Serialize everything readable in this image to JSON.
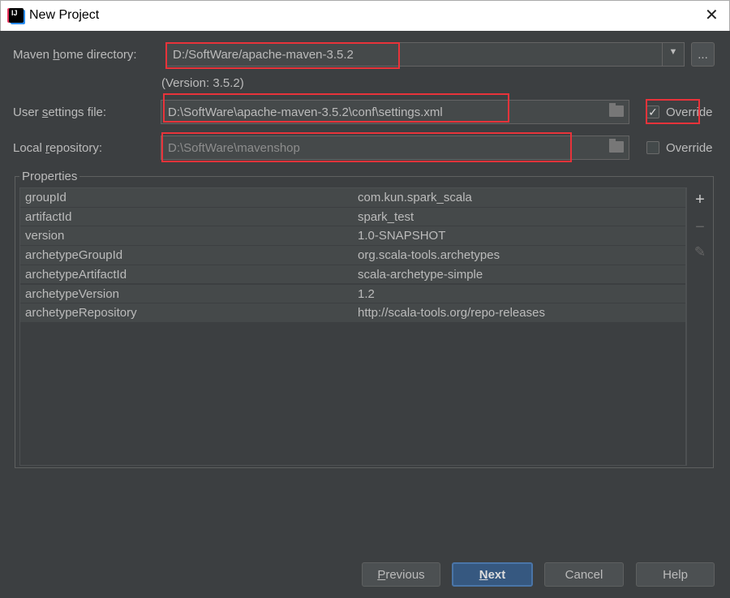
{
  "window": {
    "title": "New Project",
    "app_icon_text": "IJ"
  },
  "maven_home": {
    "label_pre": "Maven ",
    "label_u": "h",
    "label_post": "ome directory:",
    "value": "D:/SoftWare/apache-maven-3.5.2",
    "browse": "...",
    "version": "(Version: 3.5.2)"
  },
  "user_settings": {
    "label_pre": "User ",
    "label_u": "s",
    "label_post": "ettings file:",
    "value": "D:\\SoftWare\\apache-maven-3.5.2\\conf\\settings.xml",
    "override_label": "Override",
    "override_checked": true
  },
  "local_repo": {
    "label_pre": "Local ",
    "label_u": "r",
    "label_post": "epository:",
    "value": "D:\\SoftWare\\mavenshop",
    "override_label": "Override",
    "override_checked": false
  },
  "properties": {
    "title": "Properties",
    "rows": [
      {
        "key": "groupId",
        "value": "com.kun.spark_scala"
      },
      {
        "key": "artifactId",
        "value": "spark_test"
      },
      {
        "key": "version",
        "value": "1.0-SNAPSHOT"
      },
      {
        "key": "archetypeGroupId",
        "value": "org.scala-tools.archetypes"
      },
      {
        "key": "archetypeArtifactId",
        "value": "scala-archetype-simple"
      },
      {
        "key": "archetypeVersion",
        "value": "1.2"
      },
      {
        "key": "archetypeRepository",
        "value": "http://scala-tools.org/repo-releases"
      }
    ],
    "icons": {
      "add": "+",
      "remove": "−",
      "edit": "✎"
    }
  },
  "buttons": {
    "previous": {
      "u": "P",
      "rest": "revious"
    },
    "next": {
      "u": "N",
      "rest": "ext"
    },
    "cancel": "Cancel",
    "help": "Help"
  },
  "colors": {
    "background": "#3c3f41",
    "field": "#45494a",
    "primary": "#365880",
    "annotation": "#e8333a"
  }
}
